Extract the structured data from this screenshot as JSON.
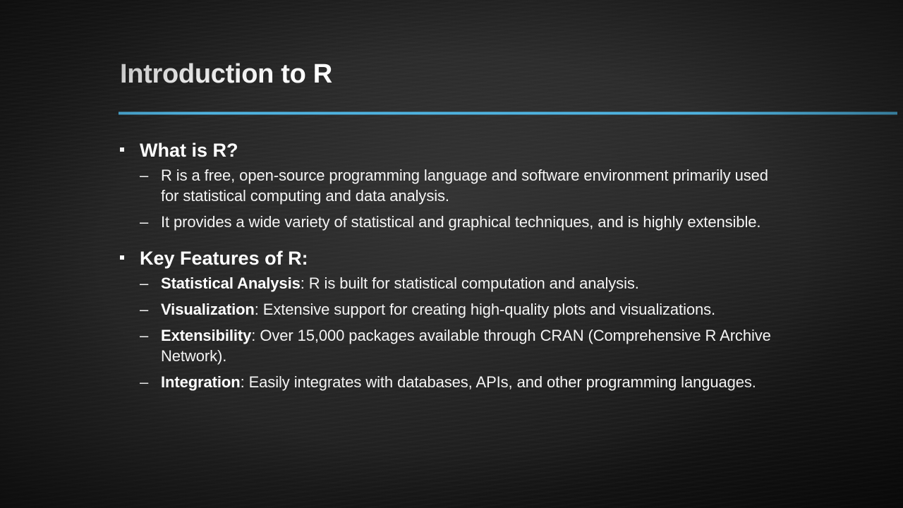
{
  "slide": {
    "title": "Introduction to R",
    "accent_color": "#4fb3e0",
    "sections": [
      {
        "heading": "What is R?",
        "items": [
          {
            "term": "",
            "text": "R is a free, open-source programming language and software environment primarily used for statistical computing and data analysis."
          },
          {
            "term": "",
            "text": "It provides a wide variety of statistical and graphical techniques, and is highly extensible."
          }
        ]
      },
      {
        "heading": "Key Features of R:",
        "items": [
          {
            "term": "Statistical Analysis",
            "text": ": R is built for statistical computation and analysis."
          },
          {
            "term": "Visualization",
            "text": ": Extensive support for creating high-quality plots and visualizations."
          },
          {
            "term": "Extensibility",
            "text": ": Over 15,000 packages available through CRAN (Comprehensive R Archive Network)."
          },
          {
            "term": "Integration",
            "text": ": Easily integrates with databases, APIs, and other programming languages."
          }
        ]
      }
    ],
    "bullet_symbol": "▪",
    "dash_symbol": "–"
  }
}
